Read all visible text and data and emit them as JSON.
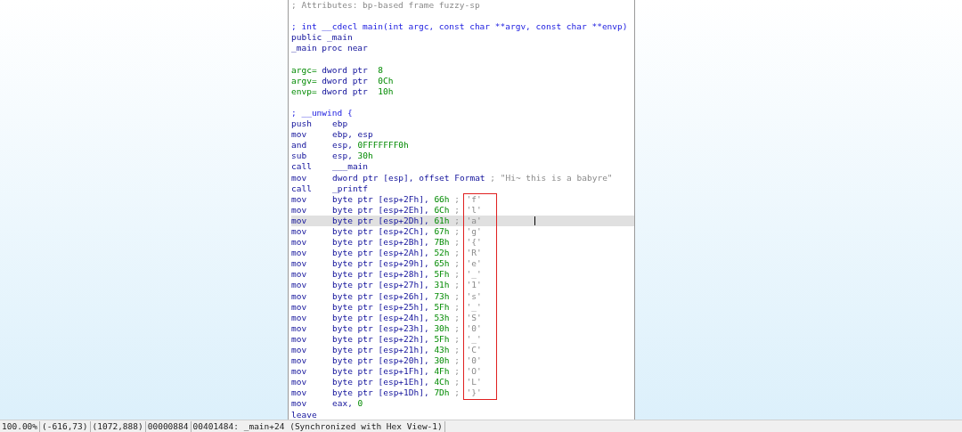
{
  "listing": {
    "lines": [
      {
        "kind": "code",
        "tokens": [
          {
            "kind": "comment",
            "text": "; Attributes: bp-based frame fuzzy-sp"
          }
        ]
      },
      {
        "kind": "blank"
      },
      {
        "kind": "code",
        "tokens": [
          {
            "kind": "proto",
            "text": "; int __cdecl main(int argc, const char **argv, const char **envp)"
          }
        ]
      },
      {
        "kind": "code",
        "tokens": [
          {
            "kind": "plain",
            "text": "public _main"
          }
        ]
      },
      {
        "kind": "code",
        "tokens": [
          {
            "kind": "plain",
            "text": "_main proc near"
          }
        ]
      },
      {
        "kind": "blank"
      },
      {
        "kind": "code",
        "tokens": [
          {
            "kind": "name",
            "text": "argc="
          },
          {
            "kind": "plain",
            "text": " dword ptr  "
          },
          {
            "kind": "num",
            "text": "8"
          }
        ]
      },
      {
        "kind": "code",
        "tokens": [
          {
            "kind": "name",
            "text": "argv="
          },
          {
            "kind": "plain",
            "text": " dword ptr  "
          },
          {
            "kind": "num",
            "text": "0Ch"
          }
        ]
      },
      {
        "kind": "code",
        "tokens": [
          {
            "kind": "name",
            "text": "envp="
          },
          {
            "kind": "plain",
            "text": " dword ptr  "
          },
          {
            "kind": "num",
            "text": "10h"
          }
        ]
      },
      {
        "kind": "blank"
      },
      {
        "kind": "code",
        "tokens": [
          {
            "kind": "proto",
            "text": "; __unwind {"
          }
        ]
      },
      {
        "kind": "code",
        "mnemonic": "push",
        "tokens": [
          {
            "kind": "plain",
            "text": "ebp"
          }
        ]
      },
      {
        "kind": "code",
        "mnemonic": "mov",
        "tokens": [
          {
            "kind": "plain",
            "text": "ebp, esp"
          }
        ]
      },
      {
        "kind": "code",
        "mnemonic": "and",
        "tokens": [
          {
            "kind": "plain",
            "text": "esp, "
          },
          {
            "kind": "num",
            "text": "0FFFFFFF0h"
          }
        ]
      },
      {
        "kind": "code",
        "mnemonic": "sub",
        "tokens": [
          {
            "kind": "plain",
            "text": "esp, "
          },
          {
            "kind": "num",
            "text": "30h"
          }
        ]
      },
      {
        "kind": "code",
        "mnemonic": "call",
        "tokens": [
          {
            "kind": "plain",
            "text": "___main"
          }
        ]
      },
      {
        "kind": "code",
        "mnemonic": "mov",
        "tokens": [
          {
            "kind": "plain",
            "text": "dword ptr [esp], offset Format"
          },
          {
            "kind": "comment",
            "text": " ; \"Hi~ this is a babyre\""
          }
        ]
      },
      {
        "kind": "code",
        "mnemonic": "call",
        "tokens": [
          {
            "kind": "plain",
            "text": "_printf"
          }
        ]
      }
    ],
    "flag_block": {
      "boxed": true,
      "rows": [
        {
          "mnemonic": "mov",
          "dest": "byte ptr [esp+2Fh], ",
          "value": "66h",
          "sep": " ;",
          "char": "'f'",
          "selected": false
        },
        {
          "mnemonic": "mov",
          "dest": "byte ptr [esp+2Eh], ",
          "value": "6Ch",
          "sep": " ;",
          "char": "'l'",
          "selected": false
        },
        {
          "mnemonic": "mov",
          "dest": "byte ptr [esp+2Dh], ",
          "value": "61h",
          "sep": " ;",
          "char": "'a'",
          "selected": true
        },
        {
          "mnemonic": "mov",
          "dest": "byte ptr [esp+2Ch], ",
          "value": "67h",
          "sep": " ;",
          "char": "'g'",
          "selected": false
        },
        {
          "mnemonic": "mov",
          "dest": "byte ptr [esp+2Bh], ",
          "value": "7Bh",
          "sep": " ;",
          "char": "'{'",
          "selected": false
        },
        {
          "mnemonic": "mov",
          "dest": "byte ptr [esp+2Ah], ",
          "value": "52h",
          "sep": " ;",
          "char": "'R'",
          "selected": false
        },
        {
          "mnemonic": "mov",
          "dest": "byte ptr [esp+29h], ",
          "value": "65h",
          "sep": " ;",
          "char": "'e'",
          "selected": false
        },
        {
          "mnemonic": "mov",
          "dest": "byte ptr [esp+28h], ",
          "value": "5Fh",
          "sep": " ;",
          "char": "'_'",
          "selected": false
        },
        {
          "mnemonic": "mov",
          "dest": "byte ptr [esp+27h], ",
          "value": "31h",
          "sep": " ;",
          "char": "'1'",
          "selected": false
        },
        {
          "mnemonic": "mov",
          "dest": "byte ptr [esp+26h], ",
          "value": "73h",
          "sep": " ;",
          "char": "'s'",
          "selected": false
        },
        {
          "mnemonic": "mov",
          "dest": "byte ptr [esp+25h], ",
          "value": "5Fh",
          "sep": " ;",
          "char": "'_'",
          "selected": false
        },
        {
          "mnemonic": "mov",
          "dest": "byte ptr [esp+24h], ",
          "value": "53h",
          "sep": " ;",
          "char": "'S'",
          "selected": false
        },
        {
          "mnemonic": "mov",
          "dest": "byte ptr [esp+23h], ",
          "value": "30h",
          "sep": " ;",
          "char": "'0'",
          "selected": false
        },
        {
          "mnemonic": "mov",
          "dest": "byte ptr [esp+22h], ",
          "value": "5Fh",
          "sep": " ;",
          "char": "'_'",
          "selected": false
        },
        {
          "mnemonic": "mov",
          "dest": "byte ptr [esp+21h], ",
          "value": "43h",
          "sep": " ;",
          "char": "'C'",
          "selected": false
        },
        {
          "mnemonic": "mov",
          "dest": "byte ptr [esp+20h], ",
          "value": "30h",
          "sep": " ;",
          "char": "'0'",
          "selected": false
        },
        {
          "mnemonic": "mov",
          "dest": "byte ptr [esp+1Fh], ",
          "value": "4Fh",
          "sep": " ;",
          "char": "'O'",
          "selected": false
        },
        {
          "mnemonic": "mov",
          "dest": "byte ptr [esp+1Eh], ",
          "value": "4Ch",
          "sep": " ;",
          "char": "'L'",
          "selected": false
        },
        {
          "mnemonic": "mov",
          "dest": "byte ptr [esp+1Dh], ",
          "value": "7Dh",
          "sep": " ;",
          "char": "'}'",
          "selected": false
        }
      ]
    },
    "tail": [
      {
        "kind": "code",
        "mnemonic": "mov",
        "tokens": [
          {
            "kind": "plain",
            "text": "eax, "
          },
          {
            "kind": "num",
            "text": "0"
          }
        ]
      },
      {
        "kind": "code",
        "tokens": [
          {
            "kind": "plain",
            "text": "leave"
          }
        ]
      }
    ]
  },
  "status_bar": [
    "100.00%",
    "(-616,73)",
    "(1072,888)",
    "00000884",
    "00401484: _main+24 (Synchronized with Hex View-1)"
  ]
}
